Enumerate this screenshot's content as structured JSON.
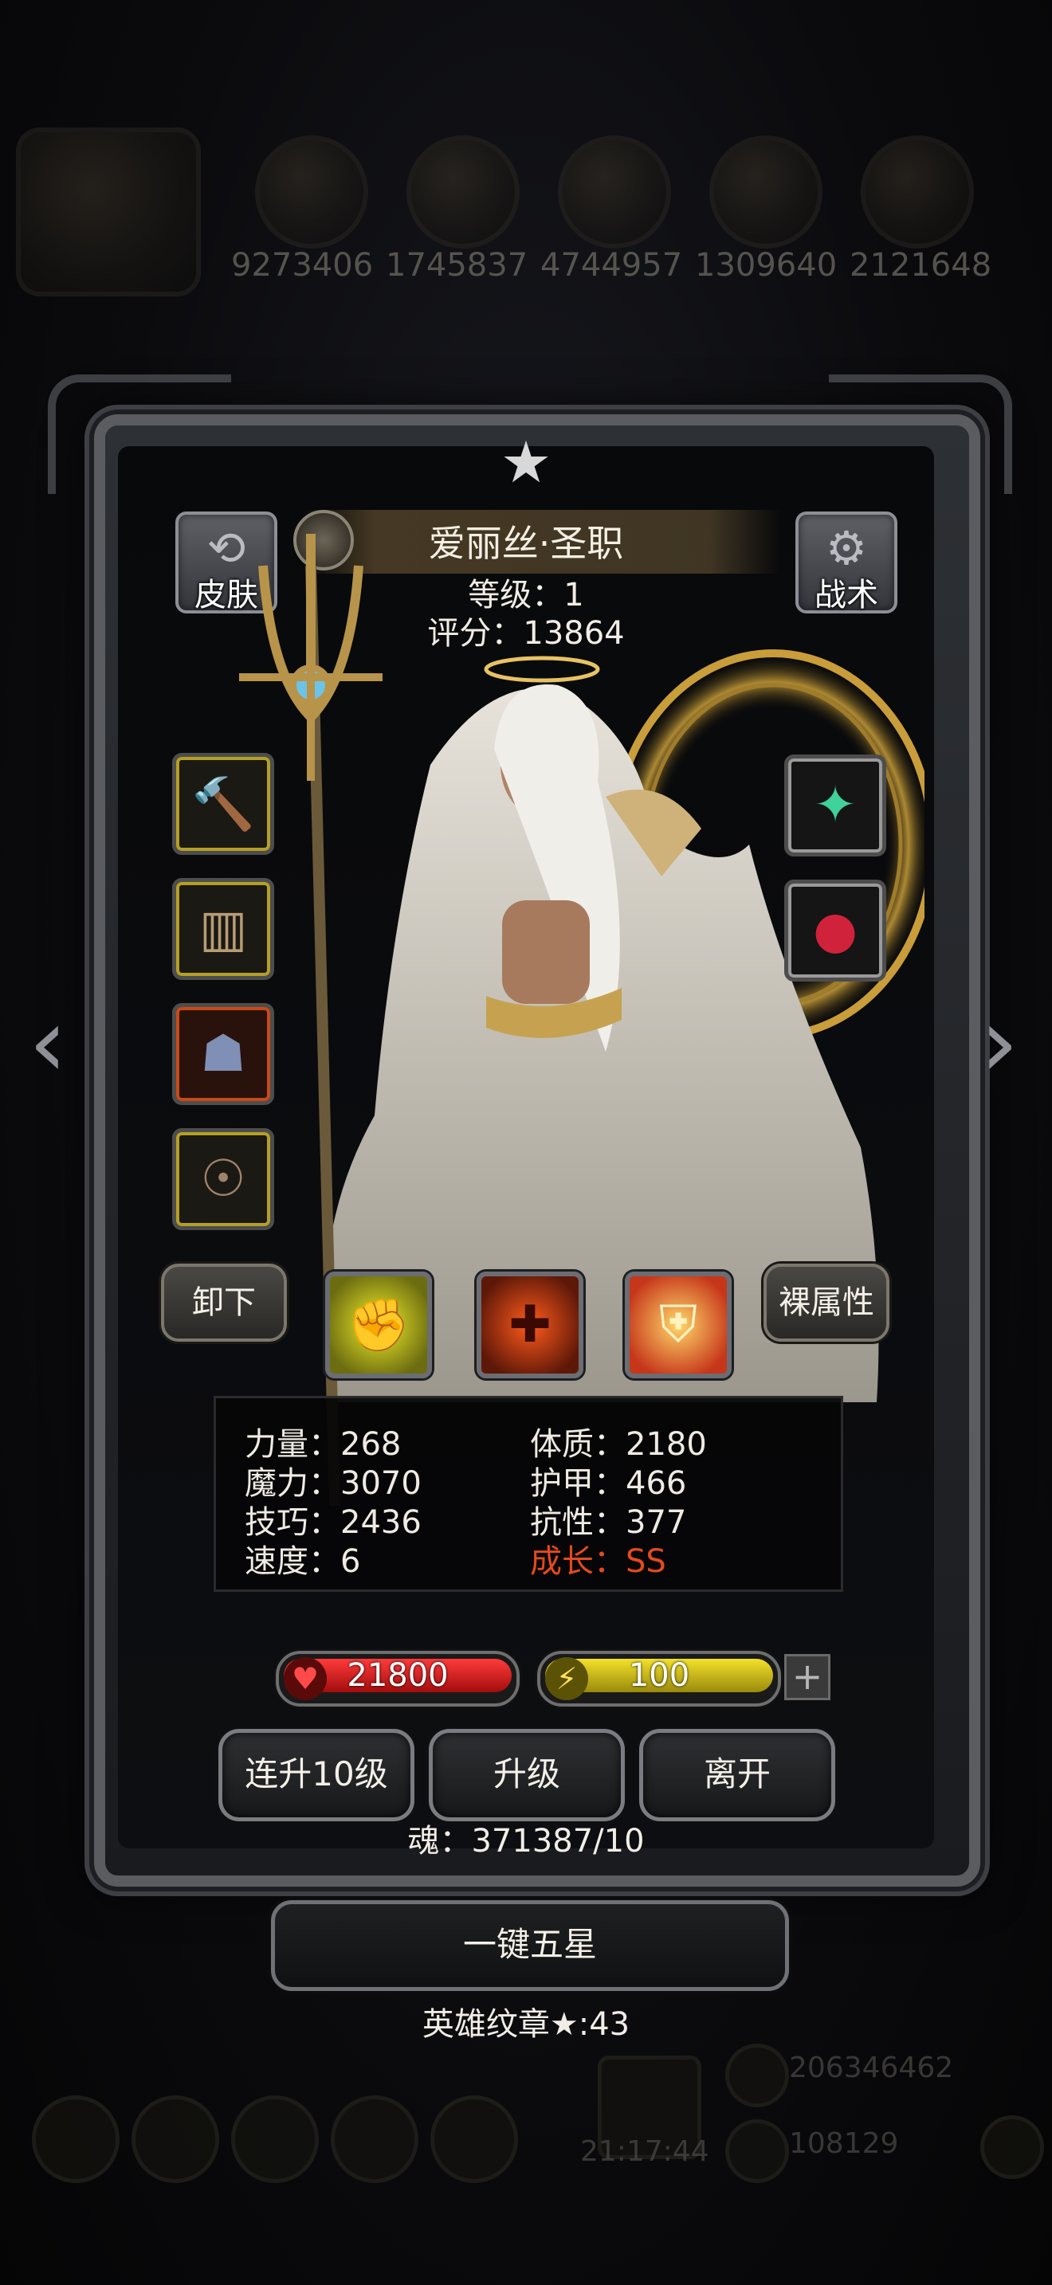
{
  "background": {
    "resource_counts": [
      "9273406",
      "1745837",
      "4744957",
      "1309640",
      "2121648"
    ],
    "gold": "206346462",
    "gems": "108129",
    "clock": "21:17:44"
  },
  "hero": {
    "name": "爱丽丝·圣职",
    "level_text": "等级：1",
    "score_text": "评分：13864"
  },
  "buttons": {
    "skin": "皮肤",
    "tactics": "战术",
    "unequip": "卸下",
    "bare_attributes": "裸属性",
    "level_up_10": "连升10级",
    "level_up": "升级",
    "leave": "离开",
    "one_key_five_star": "一键五星"
  },
  "equipment_slots": [
    {
      "icon": "hammer-weapon-icon"
    },
    {
      "icon": "fur-armor-icon"
    },
    {
      "icon": "dragon-helm-icon"
    },
    {
      "icon": "mask-icon"
    },
    {
      "icon": "green-relic-icon"
    },
    {
      "icon": "red-orb-relic-icon"
    }
  ],
  "skills": [
    {
      "icon": "fist-skill-icon"
    },
    {
      "icon": "cross-heal-skill-icon"
    },
    {
      "icon": "holy-shield-skill-icon"
    }
  ],
  "stats": {
    "strength": "力量：268",
    "constitution": "体质：2180",
    "magic": "魔力：3070",
    "armor": "护甲：466",
    "skill": "技巧：2436",
    "resistance": "抗性：377",
    "speed": "速度：6",
    "growth_label": "成长：",
    "growth_value": "SS"
  },
  "bars": {
    "hp": "21800",
    "energy": "100"
  },
  "soul_text": "魂：371387/10",
  "emblem_text": "英雄纹章★:43",
  "colors": {
    "hp": "#d41a1a",
    "energy": "#d8c519",
    "growth": "#e6491d",
    "slot_gold": "#b59f25",
    "slot_red": "#c74a18"
  }
}
